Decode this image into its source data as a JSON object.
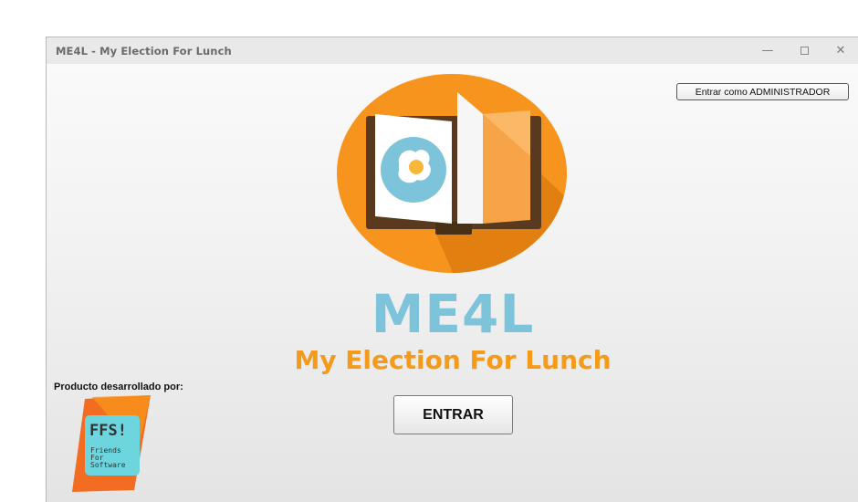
{
  "window": {
    "title": "ME4L - My Election For Lunch",
    "controls": {
      "minimize": "—",
      "close": "✕"
    }
  },
  "header": {
    "admin_button_label": "Entrar como ADMINISTRADOR"
  },
  "main": {
    "app_abbr": "ME4L",
    "app_name": "My Election For Lunch",
    "enter_button_label": "ENTRAR"
  },
  "footer": {
    "credit_label": "Producto desarrollado por:",
    "company_logo": {
      "abbr": "FFS!",
      "lines": [
        "Friends",
        "For",
        "Software"
      ]
    }
  },
  "icons": {
    "app_logo": "book-with-fried-egg-icon",
    "company_logo": "ffs-logo-icon"
  },
  "colors": {
    "brand_orange": "#f59a19",
    "brand_blue": "#7dc4db",
    "logo_circle": "#f7941d",
    "company_teal": "#6dd5dd"
  }
}
